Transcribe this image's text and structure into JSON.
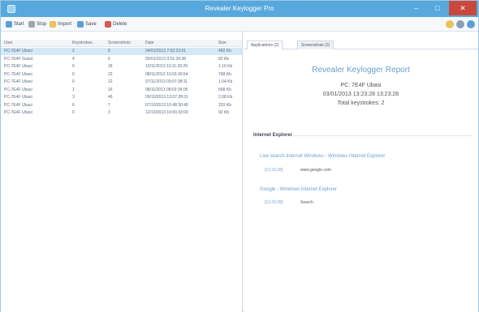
{
  "window": {
    "title": "Revealer Keylogger Pro"
  },
  "toolbar": {
    "buttons": [
      {
        "label": "Start",
        "icon": "play-icon",
        "color": "#5aa0d8"
      },
      {
        "label": "Stop",
        "icon": "stop-icon",
        "color": "#9aa6b2"
      },
      {
        "label": "Import",
        "icon": "folder-icon",
        "color": "#e8c25a"
      },
      {
        "label": "Save",
        "icon": "save-icon",
        "color": "#5aa0d8"
      },
      {
        "label": "Delete",
        "icon": "delete-icon",
        "color": "#d35a4e"
      }
    ],
    "right_icons": [
      "help-icon",
      "settings-icon",
      "support-icon"
    ]
  },
  "log_table": {
    "columns": [
      "User",
      "Keystrokes",
      "Screenshots",
      "Date",
      "Size"
    ],
    "rows": [
      [
        "PC-7E4F Ubasi",
        "2",
        "8",
        "04/01/2013 7:02:23:01",
        "460 Kb"
      ],
      [
        "PC-7E4F Guest",
        "4",
        "6",
        "05/01/2013 9:01:34:38",
        "82 Kb"
      ],
      [
        "PC-7E4F Ubasi",
        "0",
        "18",
        "10/11/2013 10:11:29:29",
        "1.16 Kb"
      ],
      [
        "PC-7E4F Ubasi",
        "0",
        "22",
        "08/11/2013 10:03:30:54",
        "768 Kb"
      ],
      [
        "PC-7E4F Ubasi",
        "0",
        "12",
        "07/11/2013 09:07:38:11",
        "1.04 Kb"
      ],
      [
        "PC-7E4F Ubasi",
        "1",
        "16",
        "08/11/2013 08:02:34:05",
        "568 Kb"
      ],
      [
        "PC-7E4F Ubasi",
        "3",
        "46",
        "09/10/2013 12:07:28:31",
        "2.08 Kb"
      ],
      [
        "PC-7E4F Ubasi",
        "6",
        "7",
        "07/10/2013 10:48:30:45",
        "203 Kb"
      ],
      [
        "PC-7E4F Ubasi",
        "0",
        "3",
        "12/10/2013 10:00:33:00",
        "92 Kb"
      ]
    ]
  },
  "tabs": [
    "Applications (2)",
    "Screenshots (2)"
  ],
  "report": {
    "title": "Revealer Keylogger Report",
    "pc": "PC: 7E4F Ubasi",
    "datetime": "03/01/2013 13:23:28 13:23:28",
    "total": "Total keystrokes: 2",
    "section": "Internet Explorer",
    "entries": [
      {
        "window": "Live search.Internet Windows - Windows Internet Explorer",
        "time": "[13:23:28]",
        "text": "www.google.com"
      },
      {
        "window": "Google - Windows Internet Explorer",
        "time": "[13:23:28]",
        "text": "Search"
      }
    ]
  }
}
